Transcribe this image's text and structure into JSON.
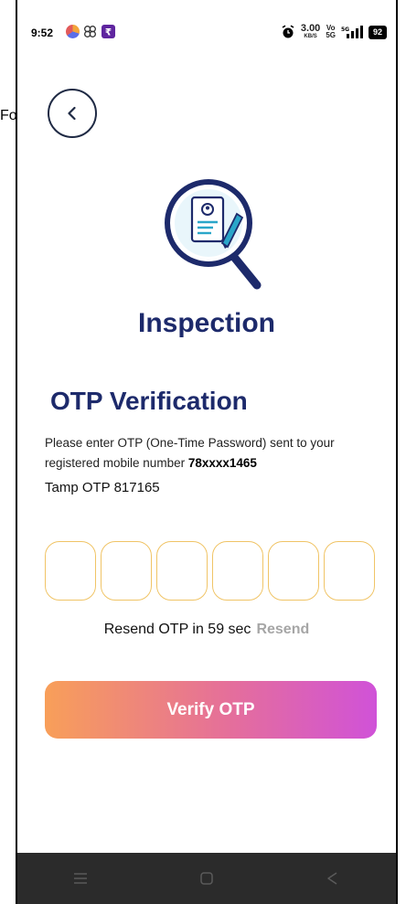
{
  "leak_text": "Fo",
  "status_bar": {
    "time": "9:52",
    "data_speed": "3.00",
    "data_unit": "KB/S",
    "volte_top": "Vo",
    "volte_bottom": "5G",
    "signal_label": "⁵⁶ˡ",
    "battery": "92"
  },
  "header": {
    "app_title": "Inspection"
  },
  "otp": {
    "title": "OTP Verification",
    "description": "Please enter OTP (One-Time Password) sent to your registered mobile number",
    "mobile": "78xxxx1465",
    "temp_otp": "Tamp OTP 817165",
    "box_count": 6,
    "resend_prefix": "Resend OTP in 59 sec",
    "resend_label": "Resend",
    "verify_label": "Verify OTP"
  },
  "colors": {
    "primary_navy": "#1d2a6b",
    "otp_box_border": "#f0c466",
    "button_gradient_start": "#f89f59",
    "button_gradient_end": "#d052d8"
  },
  "nav_icons": [
    "menu-icon",
    "home-icon",
    "back-triangle-icon"
  ]
}
